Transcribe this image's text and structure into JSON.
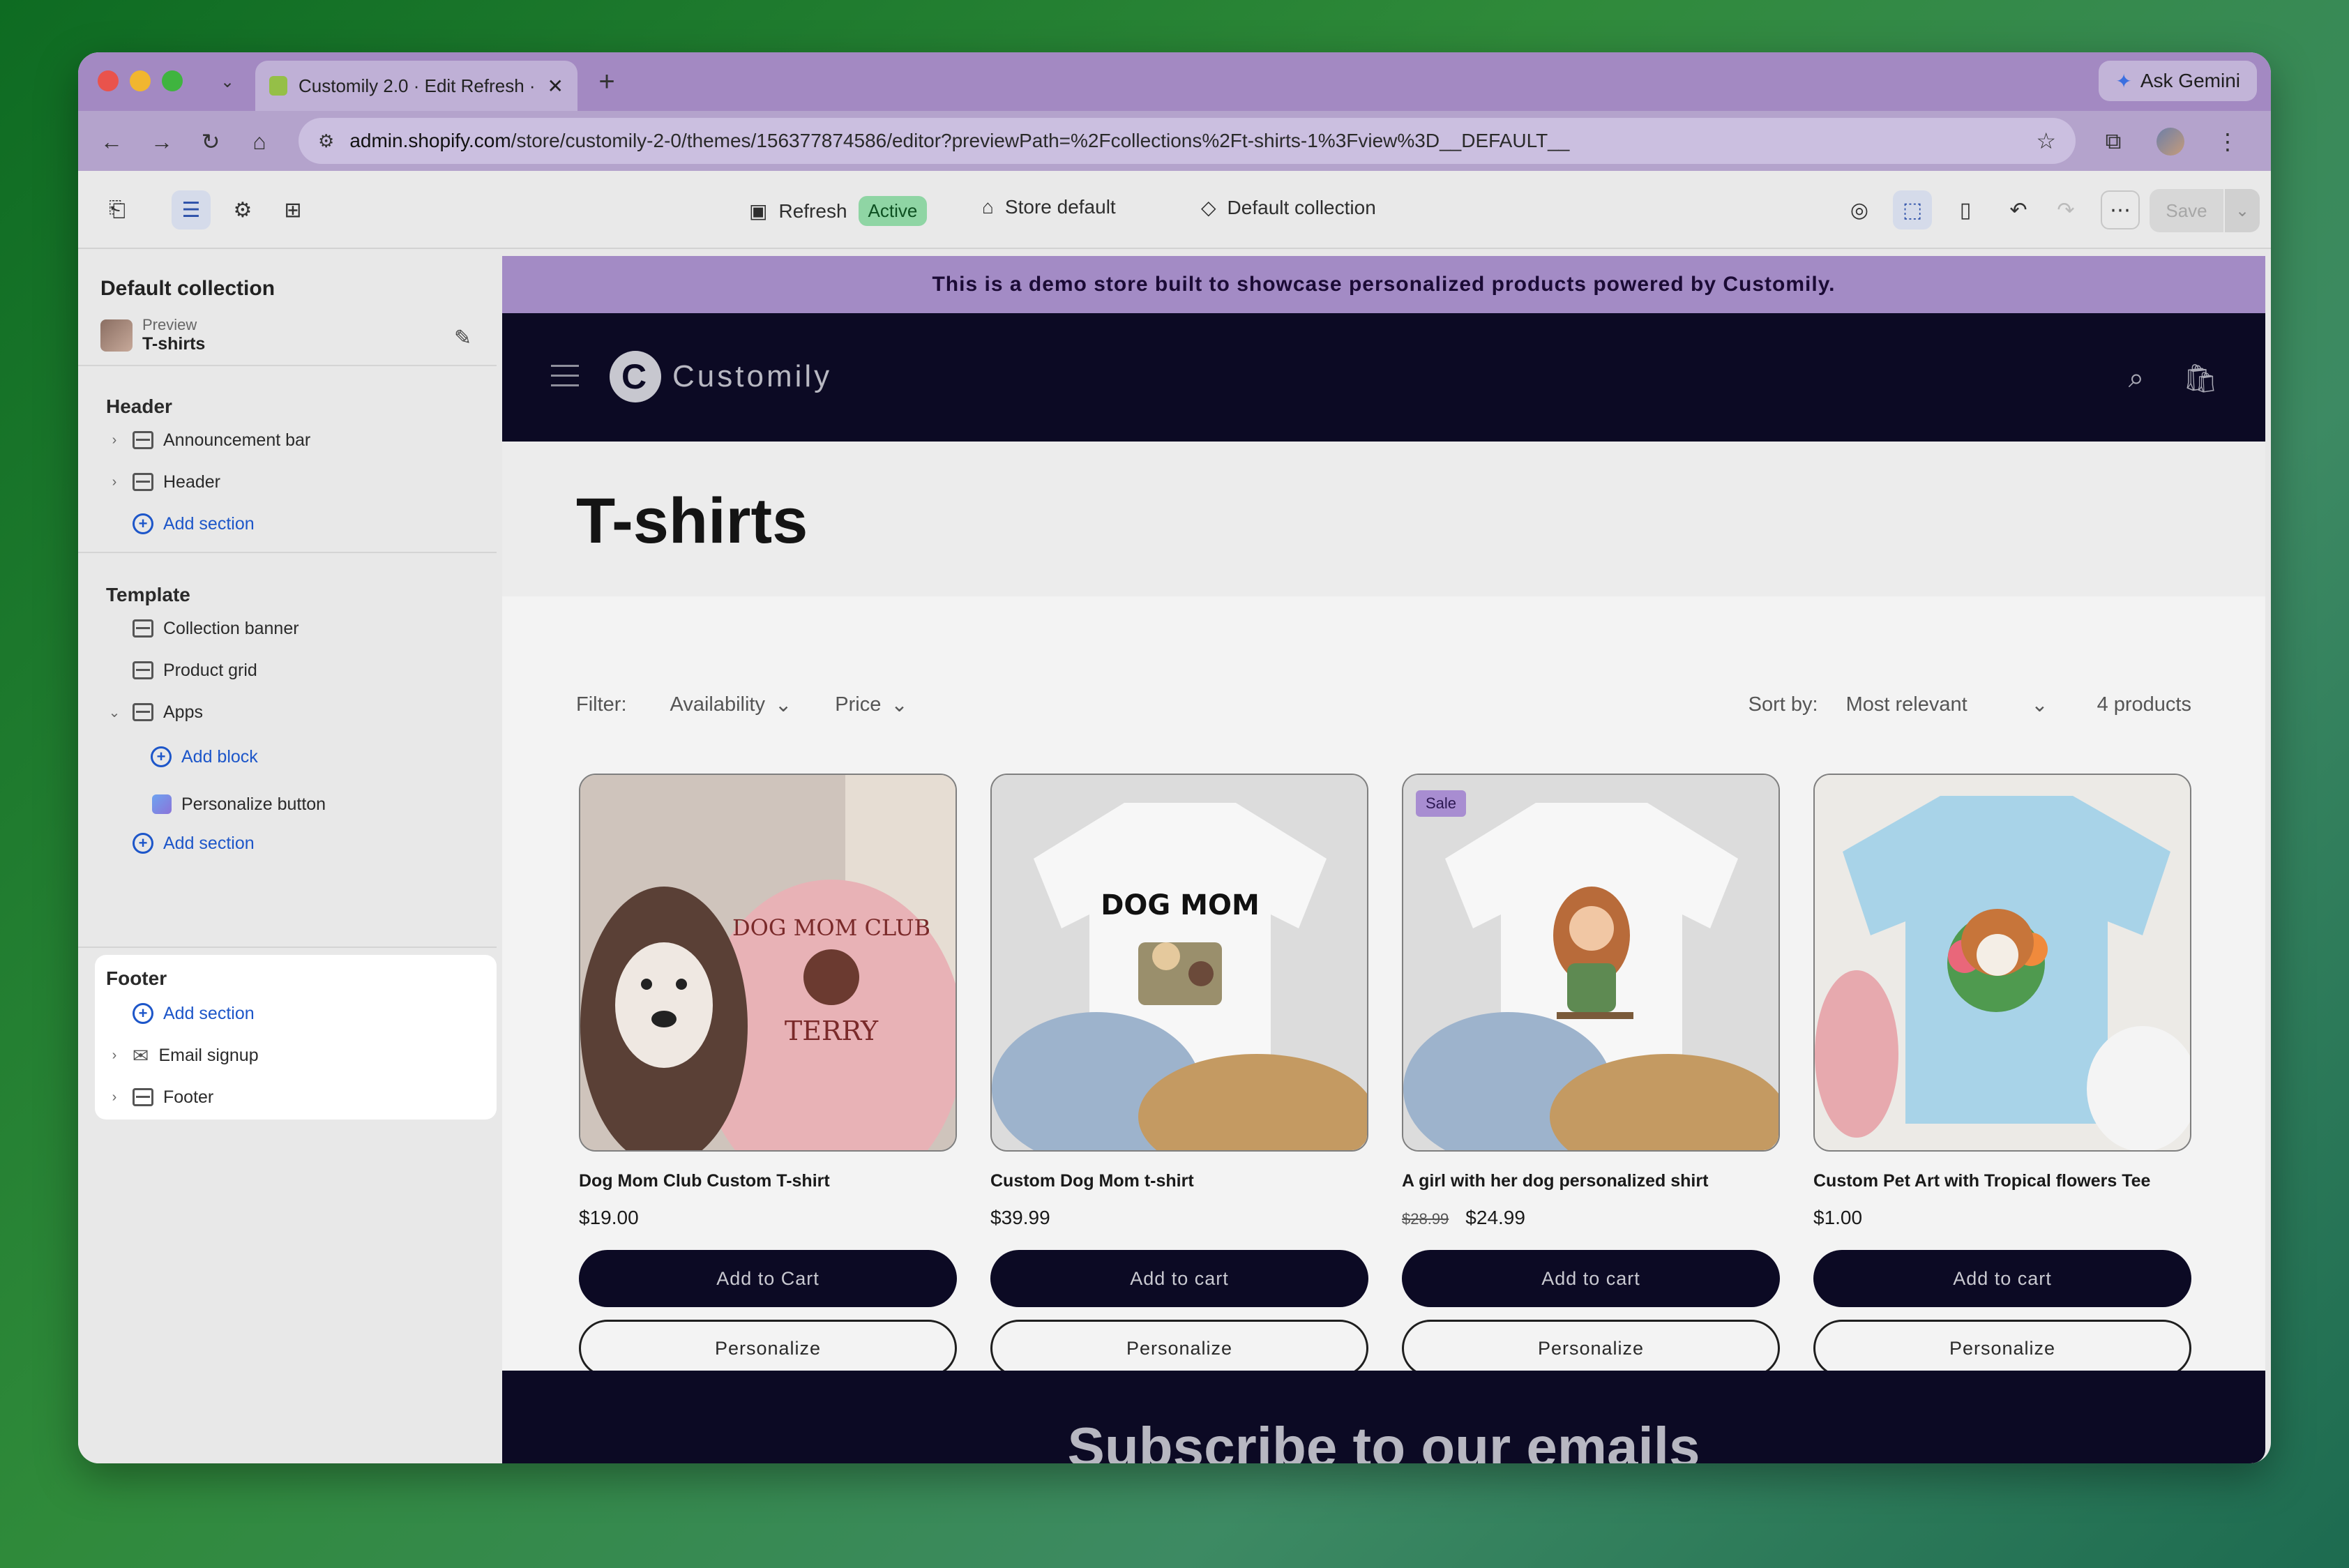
{
  "browser": {
    "tab_title": "Customily 2.0 · Edit Refresh ·",
    "url_host": "admin.shopify.com",
    "url_path": "/store/customily-2-0/themes/156377874586/editor?previewPath=%2Fcollections%2Ft-shirts-1%3Fview%3D__DEFAULT__",
    "gemini_label": "Ask Gemini"
  },
  "toolbar": {
    "theme_name": "Refresh",
    "theme_status": "Active",
    "store": "Store default",
    "template": "Default collection",
    "save_label": "Save"
  },
  "sidebar": {
    "title": "Default collection",
    "preview_label": "Preview",
    "preview_value": "T-shirts",
    "header_group": "Header",
    "header_items": [
      "Announcement bar",
      "Header"
    ],
    "add_section": "Add section",
    "template_group": "Template",
    "template_items": [
      "Collection banner",
      "Product grid",
      "Apps"
    ],
    "add_block": "Add block",
    "app_block": "Personalize button",
    "footer_group": "Footer",
    "footer_items": [
      "Email signup",
      "Footer"
    ]
  },
  "store": {
    "announcement": "This is a demo store built to showcase personalized products powered by Customily.",
    "logo_text": "Customily",
    "page_title": "T-shirts",
    "filter_label": "Filter:",
    "filter_availability": "Availability",
    "filter_price": "Price",
    "sort_label": "Sort by:",
    "sort_value": "Most relevant",
    "product_count": "4 products",
    "subscribe_heading": "Subscribe to our emails"
  },
  "products": [
    {
      "name": "Dog Mom Club Custom T-shirt",
      "price": "$19.00",
      "cart": "Add to Cart",
      "personalize": "Personalize",
      "image_text": "DOG MOM CLUB"
    },
    {
      "name": "Custom Dog Mom t-shirt",
      "price": "$39.99",
      "cart": "Add to cart",
      "personalize": "Personalize",
      "image_text": "DOG MOM"
    },
    {
      "name": "A girl with her dog personalized shirt",
      "price": "$24.99",
      "old_price": "$28.99",
      "badge": "Sale",
      "cart": "Add to cart",
      "personalize": "Personalize"
    },
    {
      "name": "Custom Pet Art with Tropical flowers Tee",
      "price": "$1.00",
      "cart": "Add to cart",
      "personalize": "Personalize"
    }
  ],
  "colors": {
    "accent_purple": "#a38bc5",
    "dark_navy": "#0c0a24",
    "link_blue": "#1d56c9",
    "active_green": "#8fd5a4"
  }
}
